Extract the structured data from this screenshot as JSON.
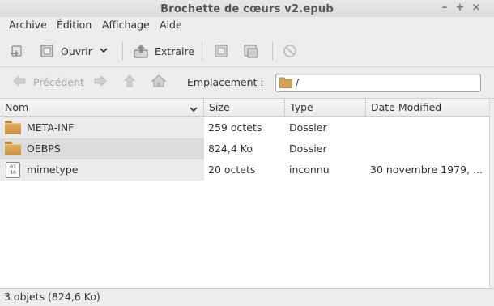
{
  "window": {
    "title": "Brochette de cœurs v2.epub",
    "buttons": {
      "minimize": "–",
      "maximize": "+",
      "close": "×"
    }
  },
  "menu": [
    "Archive",
    "Édition",
    "Affichage",
    "Aide"
  ],
  "toolbar": {
    "open_label": "Ouvrir",
    "extract_label": "Extraire"
  },
  "nav": {
    "back_label": "Précédent"
  },
  "location": {
    "label": "Emplacement :",
    "value": "/"
  },
  "columns": [
    "Nom",
    "Size",
    "Type",
    "Date Modified"
  ],
  "files": [
    {
      "name": "META-INF",
      "size": "259 octets",
      "type": "Dossier",
      "modified": "",
      "icon": "folder-icon"
    },
    {
      "name": "OEBPS",
      "size": "824,4 Ko",
      "type": "Dossier",
      "modified": "",
      "icon": "folder-icon"
    },
    {
      "name": "mimetype",
      "size": "20 octets",
      "type": "inconnu",
      "modified": "30 novembre 1979, ...",
      "icon": "binary-file-icon"
    }
  ],
  "status": "3 objets (824,6 Ko)"
}
